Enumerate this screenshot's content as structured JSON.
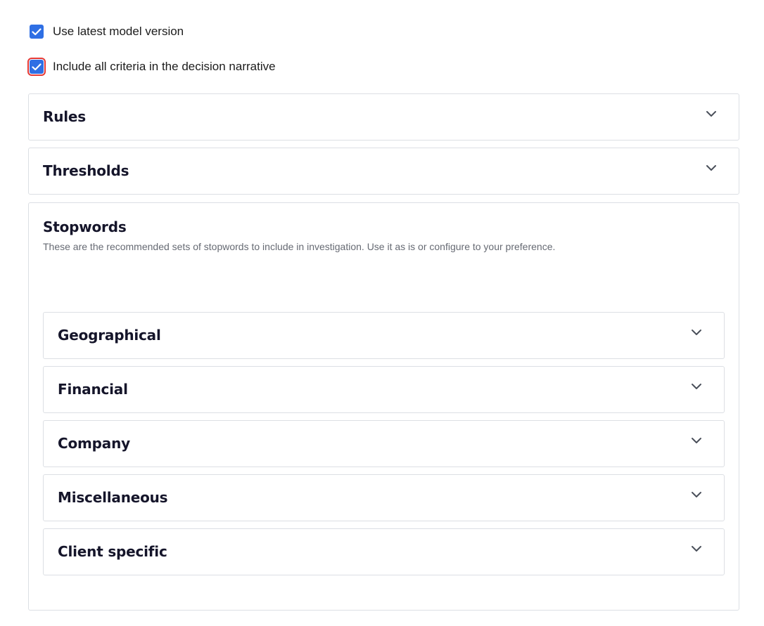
{
  "options": {
    "use_latest_model": {
      "label": "Use latest model version",
      "checked": true
    },
    "include_all_criteria": {
      "label": "Include all criteria in the decision narrative",
      "checked": true
    }
  },
  "panels": [
    {
      "title": "Rules",
      "icon": "chevron-down-icon"
    },
    {
      "title": "Thresholds",
      "icon": "chevron-down-icon"
    }
  ],
  "stopwords": {
    "title": "Stopwords",
    "description": "These are the recommended sets of stopwords to include in investigation. Use it as is or configure to your preference.",
    "groups": [
      {
        "title": "Geographical",
        "icon": "chevron-down-icon"
      },
      {
        "title": "Financial",
        "icon": "chevron-down-icon"
      },
      {
        "title": "Company",
        "icon": "chevron-down-icon"
      },
      {
        "title": "Miscellaneous",
        "icon": "chevron-down-icon"
      },
      {
        "title": "Client specific",
        "icon": "chevron-down-icon"
      }
    ]
  },
  "colors": {
    "checkbox": "#2f6fe4",
    "focus_outline": "#e53935",
    "border": "#dcdfe4"
  }
}
